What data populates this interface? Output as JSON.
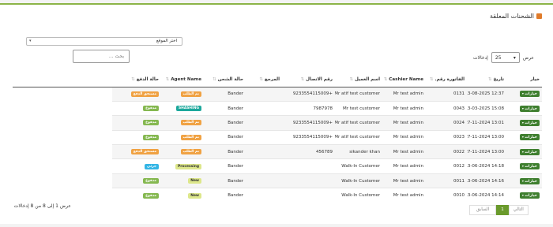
{
  "page": {
    "title": "الشحنات المعلقة"
  },
  "filters": {
    "location_placeholder": "اختر الموقع",
    "search_placeholder": "بحث ...",
    "page_size_label_before": "عرض",
    "page_size_value": "25",
    "page_size_label_after": "إدخالات"
  },
  "table": {
    "headers": [
      "خيار",
      "تاريخ",
      "الفاتورة رقم.",
      "Cashier Name",
      "اسم العميل",
      "رقم الاتصال",
      "المرجع",
      "حالة الشحن",
      "Agent Name",
      "حالة الدفع"
    ],
    "rows": [
      {
        "options": "خيارات",
        "date": "12:37 13-08-2025",
        "invoice": "0131",
        "cashier": "Mr test admin",
        "customer": "Mr atif test customer",
        "phone": "+9233554115009",
        "reference": "",
        "ship_status": "Bander",
        "agent_badge": "تم الطلب",
        "agent_color": "#f0a243",
        "payment_badge": "مستحق الدفع",
        "payment_color": "#f0a243"
      },
      {
        "options": "خيارات",
        "date": "15:08 13-03-2025",
        "invoice": "0043",
        "cashier": "Mr test admin",
        "customer": "Mr test customer",
        "phone": "7987978",
        "reference": "",
        "ship_status": "Bander",
        "agent_badge": "SHASHING",
        "agent_color": "#1da89c",
        "payment_badge": "مدفوع",
        "payment_color": "#85b850"
      },
      {
        "options": "خيارات",
        "date": "13:01 27-11-2024",
        "invoice": "0024",
        "cashier": "Mr test admin",
        "customer": "Mr atif test customer",
        "phone": "+9233554115009",
        "reference": "",
        "ship_status": "Bander",
        "agent_badge": "تم الطلب",
        "agent_color": "#f0a243",
        "payment_badge": "مدفوع",
        "payment_color": "#85b850"
      },
      {
        "options": "خيارات",
        "date": "13:00 27-11-2024",
        "invoice": "0023",
        "cashier": "Mr test admin",
        "customer": "Mr atif test customer",
        "phone": "+9233554115009",
        "reference": "",
        "ship_status": "Bander",
        "agent_badge": "تم الطلب",
        "agent_color": "#f0a243",
        "payment_badge": "مدفوع",
        "payment_color": "#85b850"
      },
      {
        "options": "خيارات",
        "date": "13:00 27-11-2024",
        "invoice": "0022",
        "cashier": "Mr test admin",
        "customer": "sikander khan",
        "phone": "456789",
        "reference": "",
        "ship_status": "Bander",
        "agent_badge": "تم الطلب",
        "agent_color": "#f0a243",
        "payment_badge": "مستحق الدفع",
        "payment_color": "#f0a243"
      },
      {
        "options": "خيارات",
        "date": "14:18 13-06-2024",
        "invoice": "0012",
        "cashier": "Mr test admin",
        "customer": "Walk-In Customer",
        "phone": "",
        "reference": "",
        "ship_status": "Bander",
        "agent_badge": "Processing",
        "agent_color": "#dde78b",
        "payment_badge": "جزئي",
        "payment_color": "#33b5e5"
      },
      {
        "options": "خيارات",
        "date": "14:16 13-06-2024",
        "invoice": "0011",
        "cashier": "Mr test admin",
        "customer": "Walk-In Customer",
        "phone": "",
        "reference": "",
        "ship_status": "Bander",
        "agent_badge": "New",
        "agent_color": "#dde78b",
        "payment_badge": "مدفوع",
        "payment_color": "#85b850"
      },
      {
        "options": "خيارات",
        "date": "14:14 13-06-2024",
        "invoice": "0010",
        "cashier": "Mr test admin",
        "customer": "Walk-In Customer",
        "phone": "",
        "reference": "",
        "ship_status": "Bander",
        "agent_badge": "New",
        "agent_color": "#dde78b",
        "payment_badge": "مدفوع",
        "payment_color": "#85b850"
      }
    ]
  },
  "footer": {
    "info": "عرض 1 إلى 8 من 8 إدخالات",
    "pagination": {
      "prev": "السابق",
      "current": "1",
      "next": "التالي"
    }
  }
}
